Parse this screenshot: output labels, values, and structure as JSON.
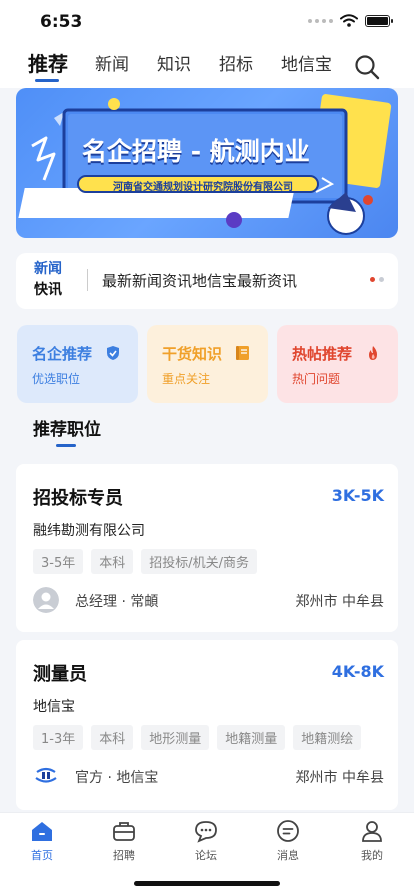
{
  "status_bar": {
    "time": "6:53"
  },
  "top_tabs": [
    "推荐",
    "新闻",
    "知识",
    "招标",
    "地信宝"
  ],
  "banner": {
    "title": "名企招聘 - 航测内业",
    "subtitle": "河南省交通规划设计研究院股份有限公司"
  },
  "news": {
    "logo_top": "新闻",
    "logo_bottom": "快讯",
    "text": "最新新闻资讯地信宝最新资讯"
  },
  "categories": [
    {
      "title": "名企推荐",
      "subtitle": "优选职位",
      "icon": "shield-icon",
      "color": "#3d7fe0",
      "bg": "#dde9fb"
    },
    {
      "title": "干货知识",
      "subtitle": "重点关注",
      "icon": "book-icon",
      "color": "#f0a02a",
      "bg": "#fdf0dc"
    },
    {
      "title": "热帖推荐",
      "subtitle": "热门问题",
      "icon": "fire-icon",
      "color": "#e0462f",
      "bg": "#fde3e5"
    }
  ],
  "section": {
    "title": "推荐职位"
  },
  "jobs": [
    {
      "title": "招投标专员",
      "salary": "3K-5K",
      "company": "融纬勘测有限公司",
      "tags": [
        "3-5年",
        "本科",
        "招投标/机关/商务"
      ],
      "poster": "总经理 · 常頔",
      "location": "郑州市 中牟县",
      "avatar": "person-avatar"
    },
    {
      "title": "测量员",
      "salary": "4K-8K",
      "company": "地信宝",
      "tags": [
        "1-3年",
        "本科",
        "地形测量",
        "地籍测量",
        "地籍测绘"
      ],
      "poster": "官方 · 地信宝",
      "location": "郑州市 中牟县",
      "avatar": "dixinbao-logo"
    }
  ],
  "tab_bar": [
    {
      "label": "首页",
      "icon": "home-icon",
      "active": true
    },
    {
      "label": "招聘",
      "icon": "briefcase-icon",
      "active": false
    },
    {
      "label": "论坛",
      "icon": "forum-icon",
      "active": false
    },
    {
      "label": "消息",
      "icon": "message-icon",
      "active": false
    },
    {
      "label": "我的",
      "icon": "profile-icon",
      "active": false
    }
  ],
  "colors": {
    "accent": "#2f6fe0",
    "background": "#f3f5f9"
  }
}
